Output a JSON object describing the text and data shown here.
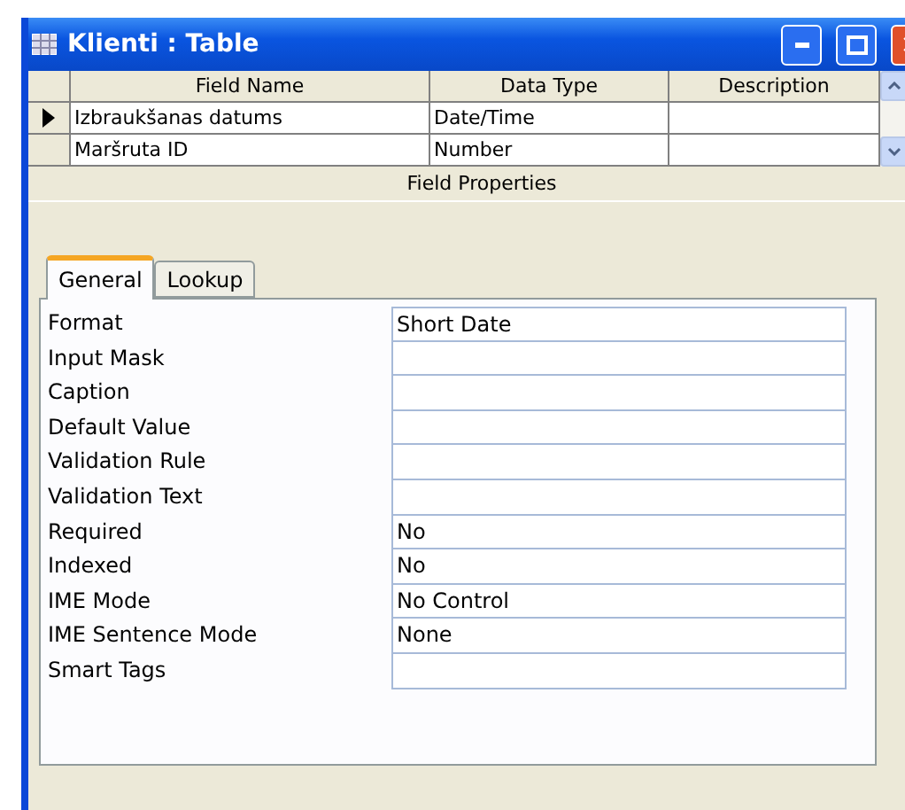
{
  "window": {
    "title": "Klienti : Table"
  },
  "table": {
    "columns": [
      "Field Name",
      "Data Type",
      "Description"
    ],
    "rows": [
      {
        "cells": [
          "Izbraukšanas datums",
          "Date/Time"
        ],
        "selected": true
      },
      {
        "cells": [
          "Maršruta ID",
          "Number"
        ],
        "selected": false
      }
    ]
  },
  "field_properties": {
    "title": "Field Properties",
    "tabs": [
      {
        "label": "General",
        "selected": true
      },
      {
        "label": "Lookup",
        "selected": false
      }
    ],
    "properties": [
      {
        "label": "Format",
        "value": "Short Date"
      },
      {
        "label": "Input Mask"
      },
      {
        "label": "Caption"
      },
      {
        "label": "Default Value"
      },
      {
        "label": "Validation Rule"
      },
      {
        "label": "Validation Text"
      },
      {
        "label": "Required",
        "value": "No"
      },
      {
        "label": "Indexed",
        "value": "No"
      },
      {
        "label": "IME Mode",
        "value": "No Control"
      },
      {
        "label": "IME Sentence Mode",
        "value": "None"
      },
      {
        "label": "Smart Tags"
      }
    ]
  }
}
